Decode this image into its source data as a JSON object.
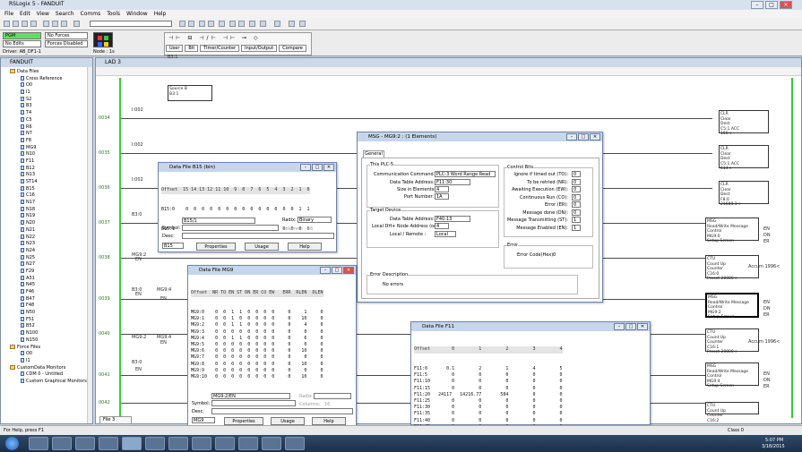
{
  "app": {
    "title": "RSLogix 5 - FANDUIT"
  },
  "menu": [
    "File",
    "Edit",
    "View",
    "Search",
    "Comms",
    "Tools",
    "Window",
    "Help"
  ],
  "status_boxes": {
    "mode": "PGM",
    "forces": "No Forces",
    "edits": "No Edits",
    "forces_disabled": "Forces Disabled",
    "driver": "Driver: AB_DF1-1",
    "node": "Node : 1s"
  },
  "instruction_tabs": [
    "User",
    "Bit",
    "Timer/Counter",
    "Input/Output",
    "Compare"
  ],
  "project": {
    "title": "FANDUIT",
    "items": [
      "Data Files",
      "Cross Reference",
      "O0",
      "I1",
      "S2",
      "B3",
      "T4",
      "C5",
      "R6",
      "N7",
      "F8",
      "MG9",
      "N10",
      "F11",
      "B12",
      "N13",
      "ST14",
      "B15",
      "C16",
      "N17",
      "N18",
      "N19",
      "N20",
      "N21",
      "N22",
      "N23",
      "N24",
      "N25",
      "N27",
      "F29",
      "A31",
      "N45",
      "F46",
      "B47",
      "F48",
      "N50",
      "F51",
      "B52",
      "N100",
      "N150",
      "Force Files",
      "O0",
      "I1",
      "CustomData Monitors",
      "CDM 0 - Untitled",
      "Custom Graphical Monitors"
    ]
  },
  "ladder": {
    "title": "LAD 3",
    "rungs": [
      "0034",
      "0035",
      "0036",
      "0037",
      "0038",
      "0039",
      "0040",
      "0041",
      "0042",
      "0043"
    ],
    "contacts": [
      "I:002",
      "I:002",
      "I:002",
      "B3:0",
      "MG9:2",
      "B3:0",
      "MG9:2",
      "B3:0",
      "MG9:4",
      "MG9:4",
      "B3:1",
      "EN",
      "EN",
      "EN",
      "EN",
      "EN"
    ],
    "instructions": [
      {
        "name": "Source B",
        "value": "B3:1"
      },
      {
        "name": "CLR",
        "line1": "Clear",
        "line2": "Dest",
        "value": "C5:1.ACC",
        "extra": "150<"
      },
      {
        "name": "CLR",
        "line1": "Clear",
        "line2": "Dest",
        "value": "C5:1.ACC",
        "extra": "614<"
      },
      {
        "name": "CLR",
        "line1": "Clear",
        "line2": "Dest",
        "value": "F8:0",
        "extra": "21680.1<"
      },
      {
        "name": "MSG",
        "line1": "Read/Write Message",
        "line2": "Control",
        "value": "MG9:0",
        "extra": "Setup Screen"
      },
      {
        "name": "CTU",
        "line1": "Count Up",
        "line2": "Counter",
        "value": "C16:0",
        "extra": "Preset 20000<"
      },
      {
        "name": "MSG",
        "line1": "Read/Write Message",
        "line2": "Control",
        "value": "MG9:2",
        "extra": "Setup Screen"
      },
      {
        "name": "CTU",
        "line1": "Count Up",
        "line2": "Counter",
        "value": "C16:1",
        "extra": "Preset 20000<"
      },
      {
        "name": "MSG",
        "line1": "Read/Write Message",
        "line2": "Control",
        "value": "MG9:4",
        "extra": "Setup Screen"
      },
      {
        "name": "CTU",
        "line1": "Count Up",
        "line2": "Counter",
        "value": "C16:2",
        "extra": ""
      }
    ],
    "accum": [
      "Accum 1996<",
      "Accum 1996<"
    ],
    "coil_labels": [
      "EN",
      "DN",
      "ER"
    ],
    "file_tab": "File 3"
  },
  "b15": {
    "title": "Data File B15 (bin)",
    "header": "Offset  15 14 13 12 11 10  9  8  7  6  5  4  3  2  1  0",
    "rows": [
      "B15:0    0  0  0  0  0  0  0  0  0  0  0  0  0  0  1  1",
      "B15:1    0  0  0  0  0  0  0  0  0  0  0  0  0  0  0  0"
    ],
    "address": "B15/1",
    "radix_label": "Radix:",
    "radix": "Binary",
    "symbol_label": "Symbol:",
    "desc_label": "Desc:",
    "columns_label": "Columns:",
    "columns": "16",
    "file": "B15",
    "buttons": [
      "Properties",
      "Usage",
      "Help"
    ]
  },
  "mg9": {
    "title": "Data File MG9",
    "header": "Offset  NR TO EN ST DN ER CO EW   ERR  RLEN  DLEN",
    "rows": [
      "MG9:0    0  0  1  1  0  0  0  0     0     1     0",
      "MG9:1    0  0  1  0  0  0  0  0     0    10     0",
      "MG9:2    0  0  1  1  0  0  0  0     0     4     0",
      "MG9:3    0  0  0  0  0  0  0  0     0     0     0",
      "MG9:4    0  0  1  1  0  0  0  0     0     6     0",
      "MG9:5    0  0  0  0  0  0  0  0     0     0     0",
      "MG9:6    0  0  0  0  0  0  0  0     0    10     0",
      "MG9:7    0  0  0  0  0  0  0  0     0     0     0",
      "MG9:8    0  0  0  0  0  0  0  0     0    10     0",
      "MG9:9    0  0  0  0  0  0  0  0     0     0     0",
      "MG9:10   0  0  0  0  0  0  0  0     0    10     0"
    ],
    "address": "MG9:2/EN",
    "radix_label": "Radix:",
    "symbol_label": "Symbol:",
    "desc_label": "Desc:",
    "columns_label": "Columns:",
    "columns": "16",
    "file": "MG9",
    "buttons": [
      "Properties",
      "Usage",
      "Help"
    ]
  },
  "msg": {
    "title": "MSG - MG9:2 : (1 Elements)",
    "tab": "General",
    "plc5_group": "This PLC-5",
    "comm_cmd_label": "Communication Command :",
    "comm_cmd": "PLC-3 Word Range Read",
    "dta_label": "Data Table Address:",
    "dta": "F11:30",
    "size_label": "Size in Elements:",
    "size": "4",
    "port_label": "Port Number:",
    "port": "1A",
    "target_group": "Target Device",
    "t_dta_label": "Data Table Address:",
    "t_dta": "F40:13",
    "local_node_label": "Local DH+ Node Address (oct):",
    "local_node": "4",
    "local_remote_label": "Local / Remote :",
    "local_remote": "Local",
    "control_group": "Control Bits",
    "control_bits": [
      {
        "label": "Ignore if timed out (TO):",
        "value": "0"
      },
      {
        "label": "To be retried (NR):",
        "value": "0"
      },
      {
        "label": "Awaiting Execution (EW):",
        "value": "0"
      },
      {
        "label": "Continuous Run (CO):",
        "value": "0"
      },
      {
        "label": "Error (ER):",
        "value": "0"
      },
      {
        "label": "Message done (DN):",
        "value": "0"
      },
      {
        "label": "Message Transmitting (ST):",
        "value": "1"
      },
      {
        "label": "Message Enabled (EN):",
        "value": "1"
      }
    ],
    "error_group": "Error",
    "error_code_label": "Error Code(Hex):",
    "error_code": "0",
    "error_desc_group": "Error Description",
    "error_desc": "No errors"
  },
  "f11": {
    "title": "Data File F11",
    "header": "Offset        0         1         2         3         4",
    "rows": [
      "F11:0       0.1         2         1         4         5",
      "F11:5         0         0         0         0         0",
      "F11:10        0         0         0         0         0",
      "F11:15        0         0         0         0         0",
      "F11:20   24117   14216.77       584         0         0",
      "F11:25        0         0         0         0         0",
      "F11:30        0         0         0         0         0",
      "F11:35        0         0         0         0         0",
      "F11:40        0         0         0         0         0",
      "F11:45        0         0         0         0         0"
    ]
  },
  "statusbar": {
    "help": "For Help, press F1",
    "right": "Class 0"
  },
  "clock": {
    "time": "5:07 PM",
    "date": "3/18/2015"
  }
}
